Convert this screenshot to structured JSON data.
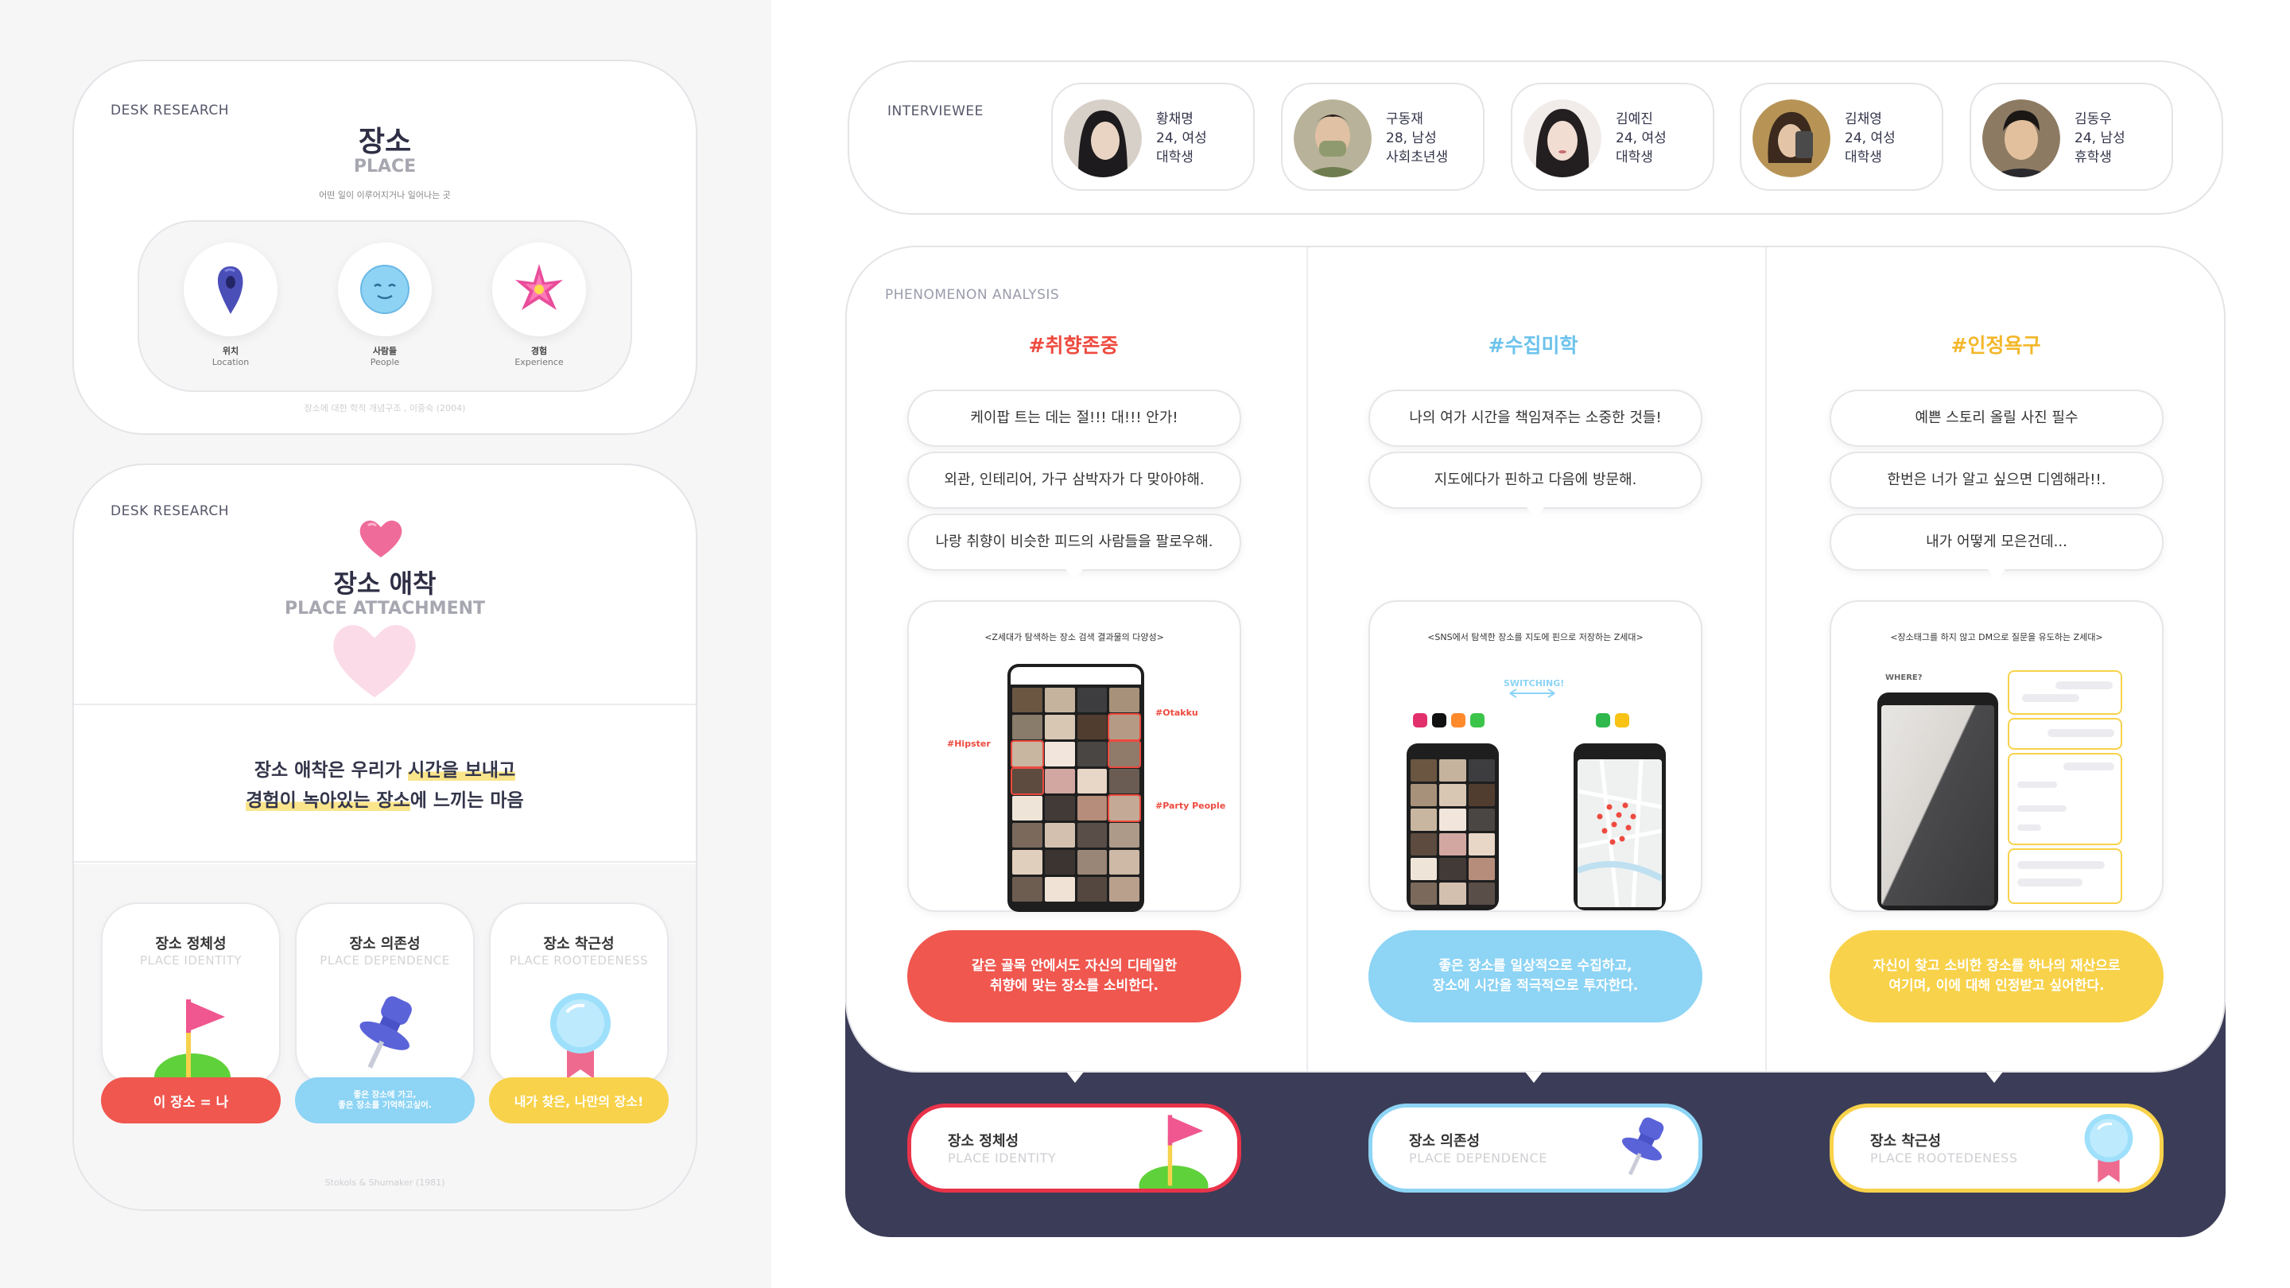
{
  "desk1": {
    "tag": "DESK RESEARCH",
    "title": "장소",
    "subtitle": "PLACE",
    "desc": "어떤 일이 이루어지거나 일어나는 곳",
    "items": [
      {
        "ko": "위치",
        "en": "Location"
      },
      {
        "ko": "사람들",
        "en": "People"
      },
      {
        "ko": "경험",
        "en": "Experience"
      }
    ],
    "source": "장소에 대한 학적 개념구조 , 이중숙 (2004)"
  },
  "desk2": {
    "tag": "DESK RESEARCH",
    "title": "장소 애착",
    "subtitle": "PLACE ATTACHMENT",
    "def_line1_a": "장소 애착은 우리가 ",
    "def_line1_b": "시간을 보내고",
    "def_line2_a": "경험이 녹아있는 장소",
    "def_line2_b": "에 느끼는 마음",
    "cards": [
      {
        "ko": "장소 정체성",
        "en": "PLACE IDENTITY",
        "pill": "이 장소 = 나"
      },
      {
        "ko": "장소 의존성",
        "en": "PLACE DEPENDENCE",
        "pill_l1": "좋은 장소에 가고,",
        "pill_l2": "좋은 장소를 기억하고싶어."
      },
      {
        "ko": "장소 착근성",
        "en": "PLACE ROOTEDENESS",
        "pill": "내가 찾은, 나만의 장소!"
      }
    ],
    "source": "Stokols & Shumaker (1981)"
  },
  "interviewee": {
    "tag": "INTERVIEWEE",
    "people": [
      {
        "name": "황채명",
        "info": "24, 여성",
        "job": "대학생"
      },
      {
        "name": "구동재",
        "info": "28, 남성",
        "job": "사회초년생"
      },
      {
        "name": "김예진",
        "info": "24, 여성",
        "job": "대학생"
      },
      {
        "name": "김채영",
        "info": "24, 여성",
        "job": "대학생"
      },
      {
        "name": "김동우",
        "info": "24, 남성",
        "job": "휴학생"
      }
    ]
  },
  "analysis": {
    "tag": "PHENOMENON ANALYSIS",
    "columns": [
      {
        "hashtag": "#취향존중",
        "bubbles": [
          "케이팝 트는 데는 절!!! 대!!! 안가!",
          "외관, 인테리어, 가구 삼박자가 다 맞아야해.",
          "나랑 취향이 비슷한 피드의 사람들을 팔로우해."
        ],
        "shot_caption": "<Z세대가 탐색하는 장소 검색 결과물의 다양성>",
        "labels": [
          "#Otakku",
          "#Hipster",
          "#Party People"
        ],
        "result_l1": "같은 골목 안에서도 자신의 디테일한",
        "result_l2": "취향에 맞는 장소를 소비한다.",
        "bottom_ko": "장소 정체성",
        "bottom_en": "PLACE IDENTITY"
      },
      {
        "hashtag": "#수집미학",
        "bubbles": [
          "나의 여가 시간을 책임져주는 소중한 것들!",
          "지도에다가 핀하고 다음에 방문해."
        ],
        "shot_caption": "<SNS에서 탐색한 장소를 지도에 핀으로 저장하는 Z세대>",
        "labels": [
          "SWITCHING!"
        ],
        "result_l1": "좋은 장소를 일상적으로 수집하고,",
        "result_l2": "장소에 시간을 적극적으로 투자한다.",
        "bottom_ko": "장소 의존성",
        "bottom_en": "PLACE DEPENDENCE"
      },
      {
        "hashtag": "#인정욕구",
        "bubbles": [
          "예쁜 스토리 올릴 사진 필수",
          "한번은 너가 알고 싶으면 디엠해라!!.",
          "내가 어떻게 모은건데..."
        ],
        "shot_caption": "<장소태그를 하지 않고 DM으로 질문을 유도하는 Z세대>",
        "labels": [
          "WHERE?"
        ],
        "result_l1": "자신이 찾고 소비한 장소를 하나의 재산으로",
        "result_l2": "여기며, 이에 대해 인정받고 싶어한다.",
        "bottom_ko": "장소 착근성",
        "bottom_en": "PLACE ROOTEDENESS"
      }
    ]
  },
  "colors": {
    "red": "#f0574f",
    "blue": "#8dd4f5",
    "yellow": "#f8d24a",
    "navy": "#3b3c57",
    "red_text": "#ee4a3f",
    "blue_text": "#6cc3ec",
    "yellow_text": "#f3b72a"
  }
}
